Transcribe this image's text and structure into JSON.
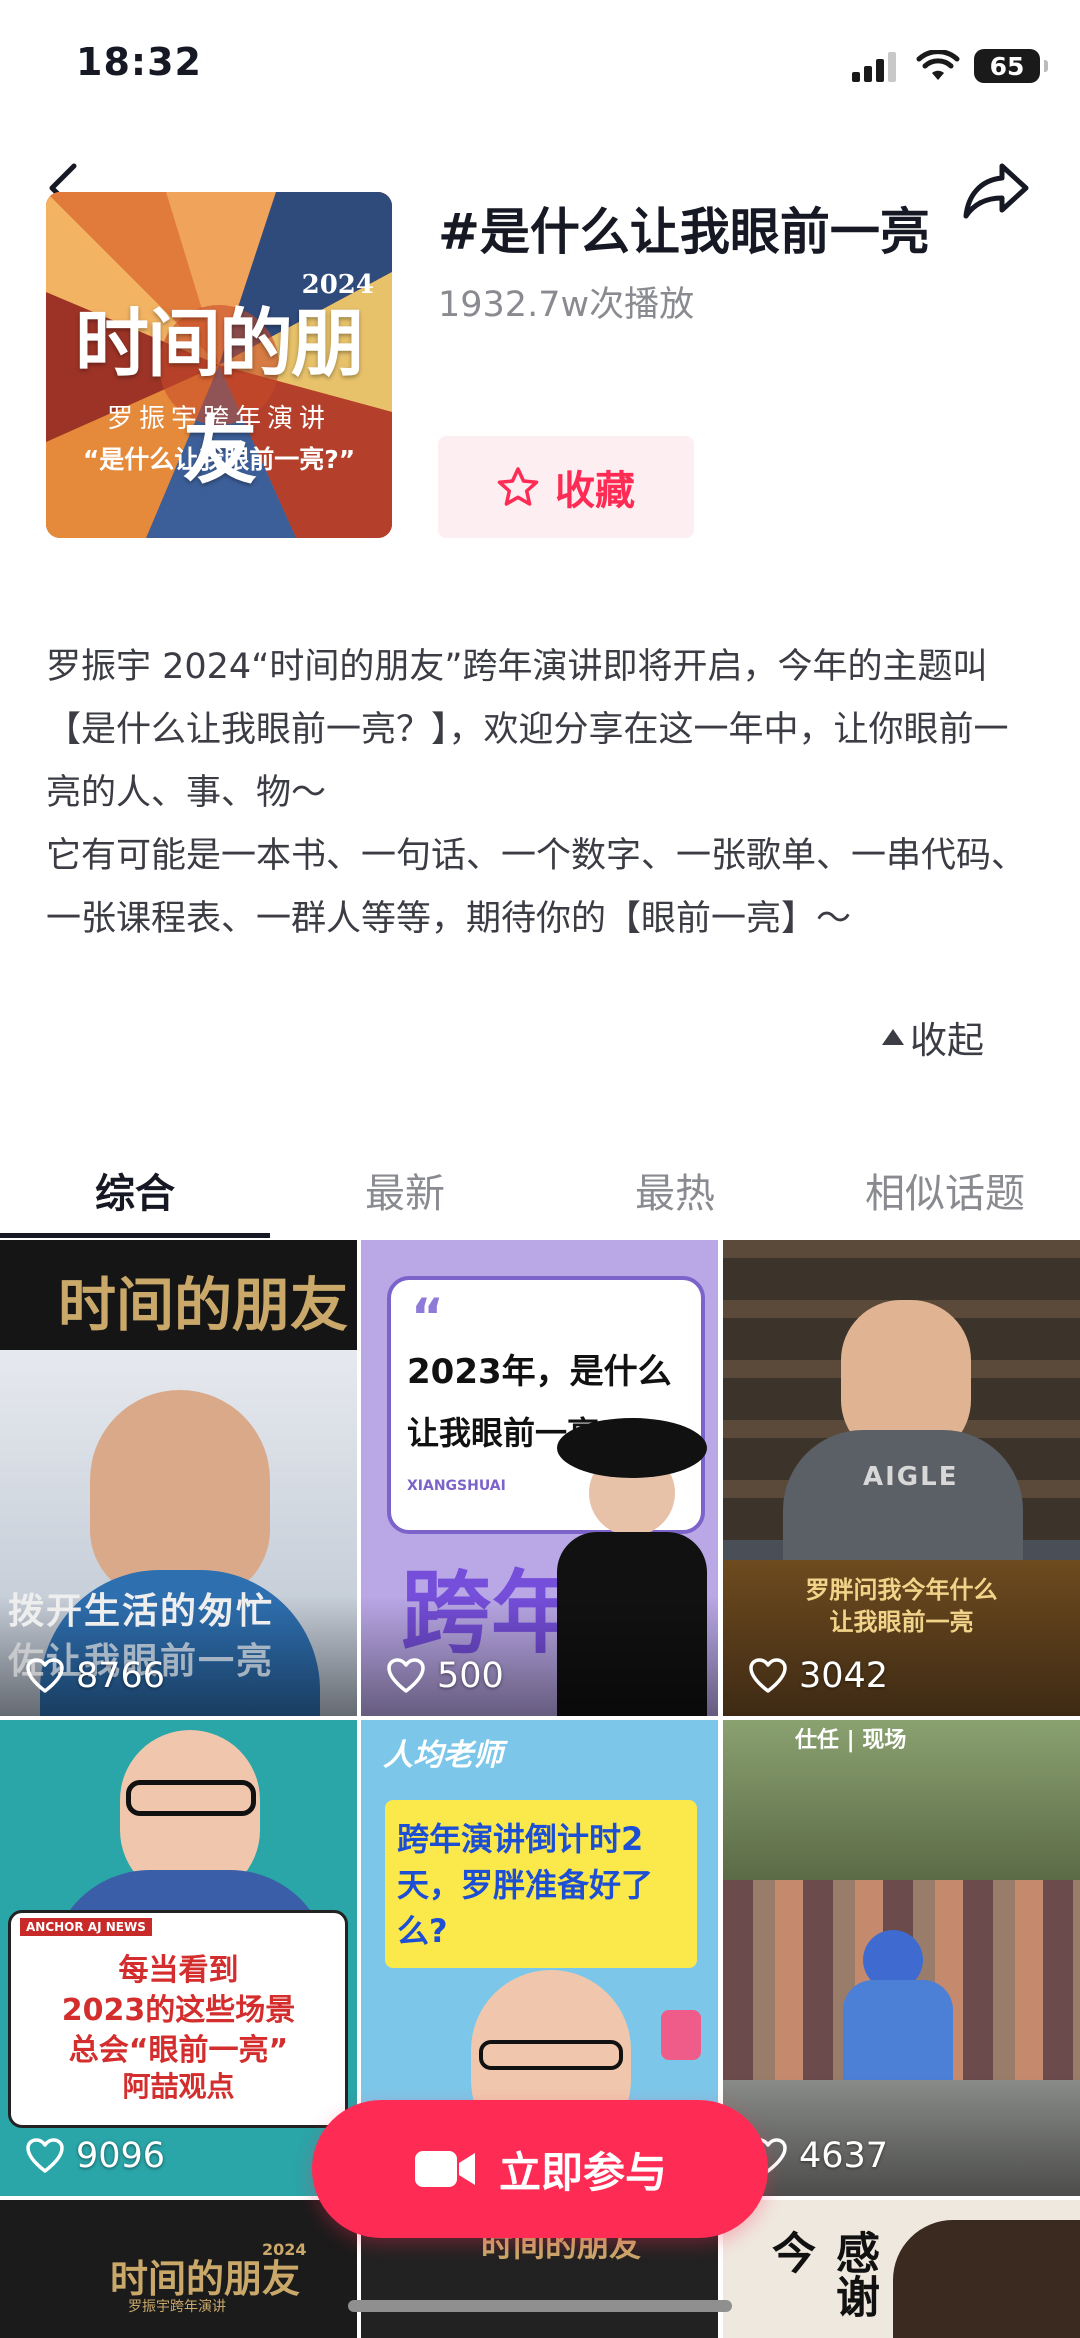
{
  "status_bar": {
    "time": "18:32",
    "battery": "65"
  },
  "topic": {
    "title": "#是什么让我眼前一亮",
    "play_count": "1932.7w次播放",
    "favorite_label": "收藏",
    "cover": {
      "title": "时间的朋友",
      "year": "2024",
      "subtitle": "罗振宇跨年演讲",
      "tagline": "“是什么让我眼前一亮?”"
    }
  },
  "description": {
    "paragraph1": "罗振宇 2024“时间的朋友”跨年演讲即将开启，今年的主题叫【是什么让我眼前一亮？】，欢迎分享在这一年中，让你眼前一亮的人、事、物～",
    "paragraph2": "它有可能是一本书、一句话、一个数字、一张歌单、一串代码、一张课程表、一群人等等，期待你的【眼前一亮】～",
    "collapse_label": "收起"
  },
  "tabs": [
    {
      "label": "综合",
      "active": true
    },
    {
      "label": "最新",
      "active": false
    },
    {
      "label": "最热",
      "active": false
    },
    {
      "label": "相似话题",
      "active": false
    }
  ],
  "videos": [
    {
      "likes": "8766",
      "caption_line1": "拨开生活的匆忙",
      "caption_line2": "佐让我眼前一亮"
    },
    {
      "likes": "500",
      "headline": "2023年，是什么",
      "headline2": "让我眼前一亮?",
      "tag": "XIANGSHUAI",
      "overlay": "跨年"
    },
    {
      "likes": "3042",
      "shirt": "AIGLE",
      "caption_line1": "罗胖问我今年什么",
      "caption_line2": "让我眼前一亮"
    },
    {
      "likes": "9096",
      "badge": "ANCHOR AJ NEWS",
      "caption_line1": "每当看到",
      "caption_line2": "2023的这些场景",
      "caption_line3": "总会“眼前一亮”",
      "caption_line4": "阿喆观点"
    },
    {
      "likes": "",
      "header": "人均老师",
      "headline": "跨年演讲倒计时2天，罗胖准备好了么?"
    },
    {
      "likes": "4637",
      "header": "仕任 | 现场"
    },
    {
      "caption": "时间的朋友",
      "year": "2024",
      "sub": "罗振宇跨年演讲"
    },
    {
      "caption": "时间的朋友"
    },
    {
      "caption": "感谢 今"
    }
  ],
  "join_button": {
    "label": "立即参与"
  },
  "colors": {
    "accent": "#fe2c55",
    "text_primary": "#161823",
    "text_secondary": "#8a8b91"
  }
}
